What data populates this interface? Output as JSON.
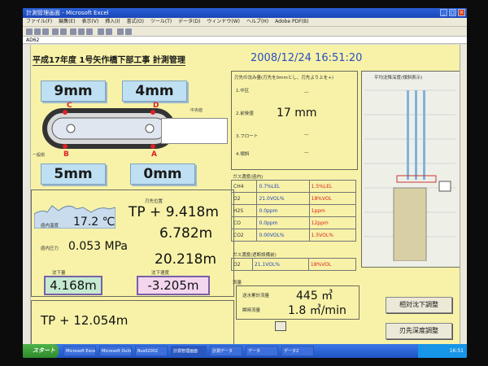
{
  "window": {
    "title": "計測管理画面 - Microsoft Excel",
    "menu": [
      "ファイル(F)",
      "編集(E)",
      "表示(V)",
      "挿入(I)",
      "書式(O)",
      "ツール(T)",
      "データ(D)",
      "ウィンドウ(W)",
      "ヘルプ(H)",
      "Adobe PDF(B)"
    ],
    "cell_ref": "AD62"
  },
  "header": {
    "title": "平成17年度 1号矢作橋下部工事 計測管理",
    "datetime": "2008/12/24 16:51:20"
  },
  "caisson": {
    "c_value": "9mm",
    "d_value": "4mm",
    "b_value": "5mm",
    "a_value": "0mm",
    "points": [
      "C",
      "D",
      "B",
      "A"
    ],
    "note_label": "中央値",
    "left_label": "一般側"
  },
  "readings": {
    "temperature": "17.2 ℃",
    "pressure": "0.053 MPa",
    "tp_main": "TP + 9.418m",
    "value2": "6.782m",
    "value3": "20.218m",
    "box1": "4.168m",
    "box2": "-3.205m",
    "tp_bottom": "TP + 12.054m",
    "label_temp": "函内温度",
    "label_pressure": "函内圧力",
    "label_tp": "刃先位置",
    "label_box1": "沈下量",
    "label_box2": "沈下速度"
  },
  "edge_status": {
    "heading": "刃先の沈み量(刃先を0mmとし、刃先より上を+)",
    "row1_label": "1.中区",
    "row1_value": "—",
    "row2_label": "2.前後値",
    "row2_value": "17 mm",
    "row3_label": "3.フロート",
    "row3_value": "—",
    "row4_label": "4.傾斜",
    "row4_value": "—"
  },
  "gas_table": {
    "heading": "ガス濃度(函内)",
    "rows": [
      {
        "gas": "CH4",
        "value": "0.7%LEL",
        "limit": "1.5%LEL"
      },
      {
        "gas": "O2",
        "value": "21.0VOL%",
        "limit": "18%VOL"
      },
      {
        "gas": "H2S",
        "value": "0.0ppm",
        "limit": "1ppm"
      },
      {
        "gas": "CO",
        "value": "0.0ppm",
        "limit": "12ppm"
      },
      {
        "gas": "CO2",
        "value": "0.00VOL%",
        "limit": "1.5VOL%"
      }
    ],
    "heading2": "ガス濃度(遮断設備前)",
    "o2_row": {
      "gas": "O2",
      "value": "21.1VOL%",
      "limit": "18%VOL"
    }
  },
  "flow": {
    "heading": "流量",
    "label1": "送水累計流量",
    "value1": "445 ㎥",
    "label2": "瞬時流量",
    "value2": "1.8 ㎥/min"
  },
  "buttons": {
    "settle_adjust": "相対沈下調整",
    "depth_adjust": "刃先深度調整"
  },
  "diagram": {
    "title": "平均沈降深度(傾斜表示)",
    "bar_colors": [
      "#7fb3e0",
      "#7fb3e0",
      "#7fb3e0"
    ]
  },
  "taskbar": {
    "start": "スタート",
    "tasks": [
      "Microsoft Excel",
      "Microsoft Outlook",
      "Bus02002",
      "計測管理画面",
      "計測データ",
      "データ",
      "データ2"
    ],
    "clock": "16:51"
  }
}
